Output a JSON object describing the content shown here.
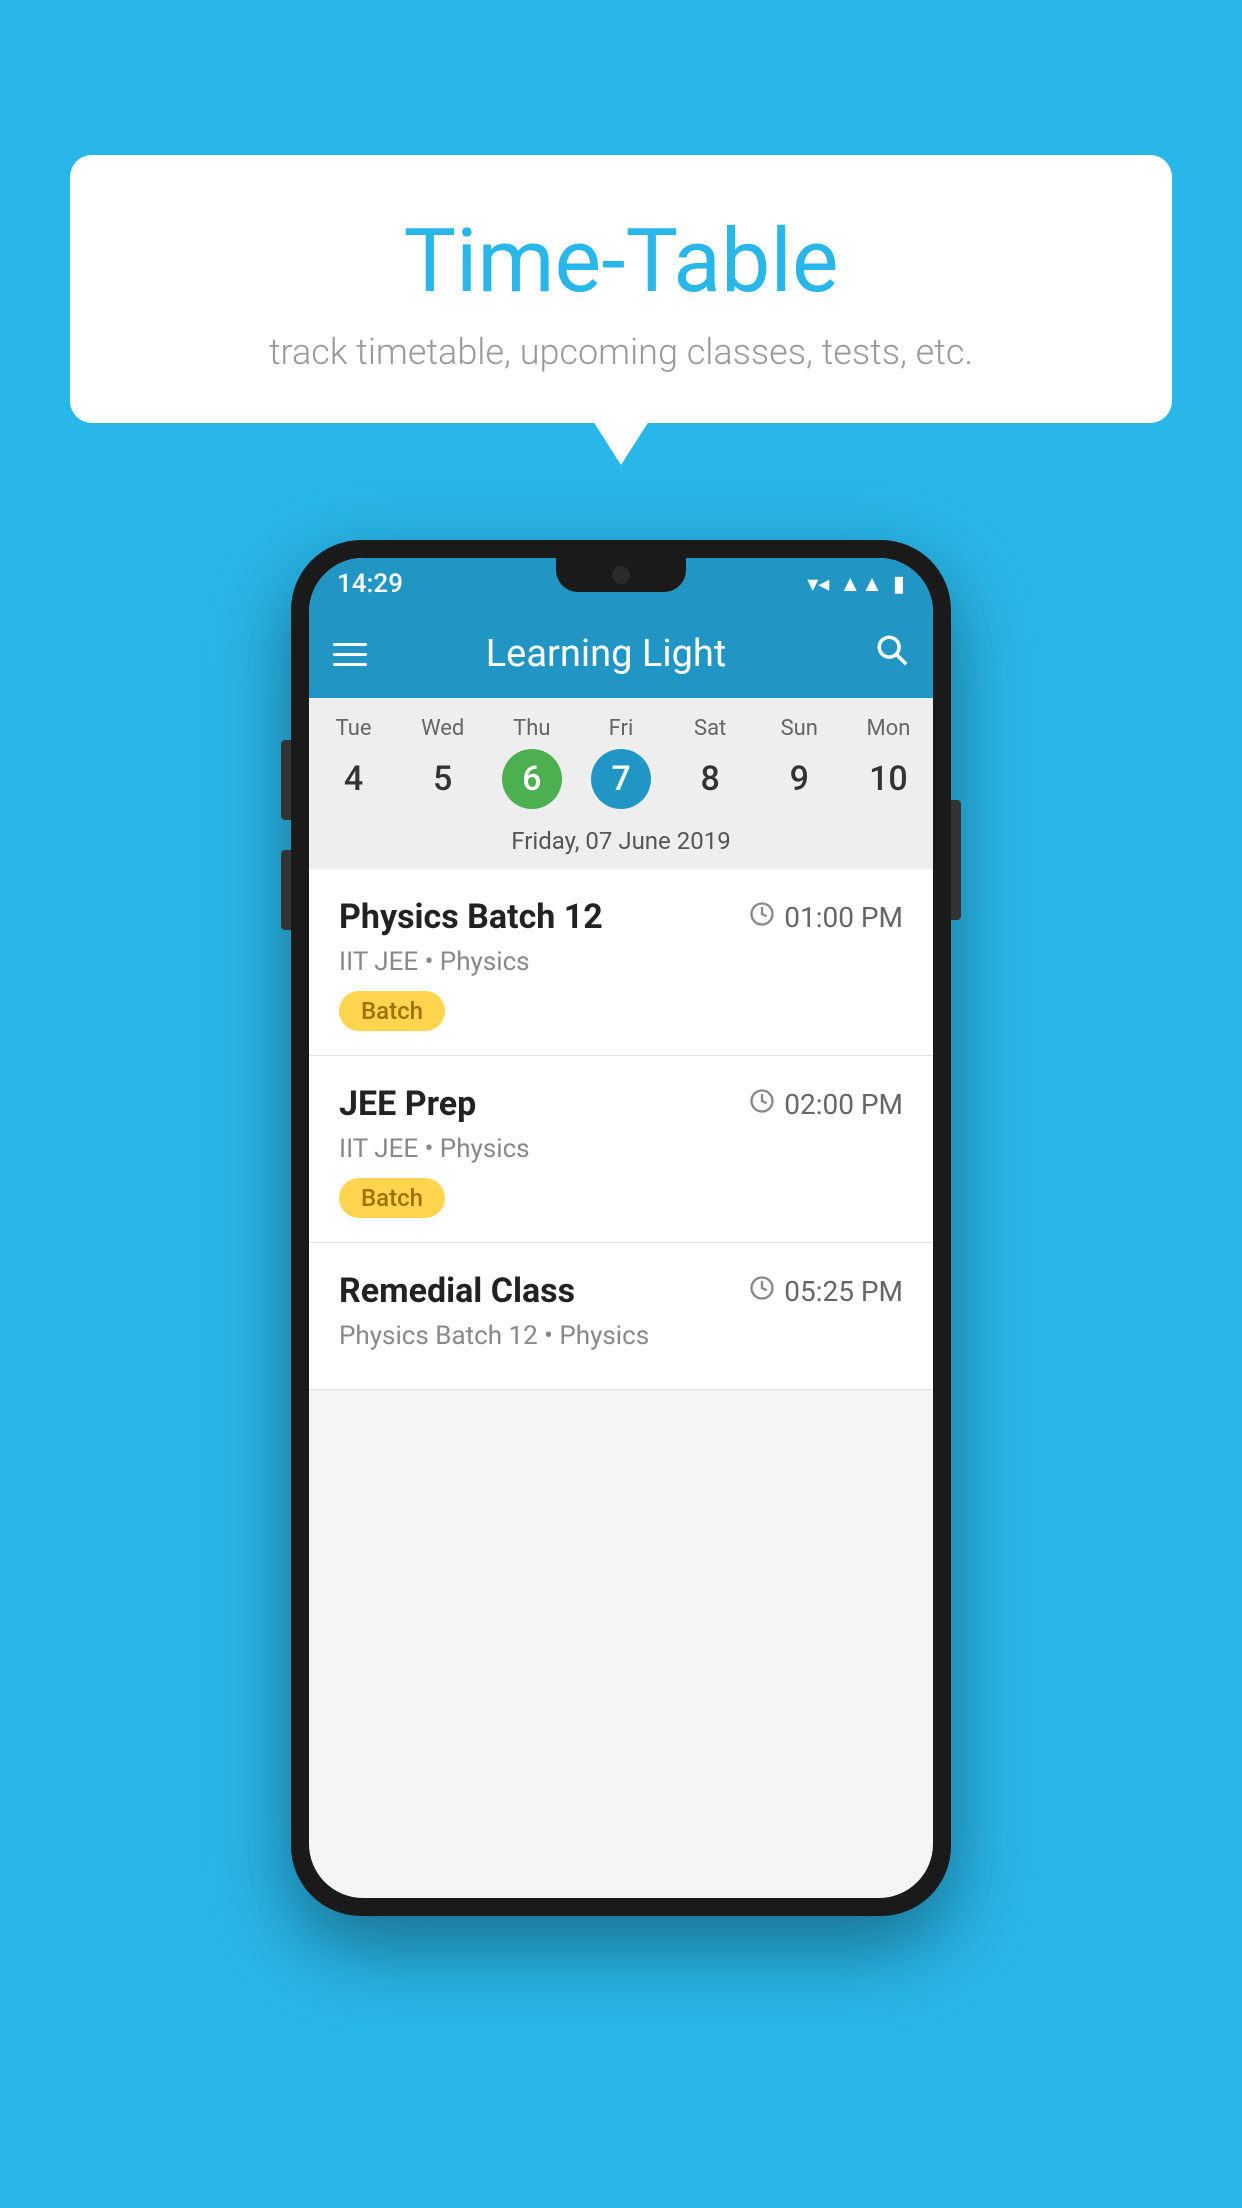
{
  "background_color": "#29b6e8",
  "bubble": {
    "title": "Time-Table",
    "subtitle": "track timetable, upcoming classes, tests, etc."
  },
  "status_bar": {
    "time": "14:29"
  },
  "app_bar": {
    "title": "Learning Light"
  },
  "calendar": {
    "days": [
      {
        "name": "Tue",
        "num": "4",
        "state": "normal"
      },
      {
        "name": "Wed",
        "num": "5",
        "state": "normal"
      },
      {
        "name": "Thu",
        "num": "6",
        "state": "today"
      },
      {
        "name": "Fri",
        "num": "7",
        "state": "selected"
      },
      {
        "name": "Sat",
        "num": "8",
        "state": "normal"
      },
      {
        "name": "Sun",
        "num": "9",
        "state": "normal"
      },
      {
        "name": "Mon",
        "num": "10",
        "state": "normal"
      }
    ],
    "selected_label": "Friday, 07 June 2019"
  },
  "schedule": [
    {
      "name": "Physics Batch 12",
      "time": "01:00 PM",
      "meta": "IIT JEE • Physics",
      "badge": "Batch"
    },
    {
      "name": "JEE Prep",
      "time": "02:00 PM",
      "meta": "IIT JEE • Physics",
      "badge": "Batch"
    },
    {
      "name": "Remedial Class",
      "time": "05:25 PM",
      "meta": "Physics Batch 12 • Physics",
      "badge": ""
    }
  ],
  "icons": {
    "hamburger": "☰",
    "search": "🔍",
    "clock": "🕐"
  }
}
